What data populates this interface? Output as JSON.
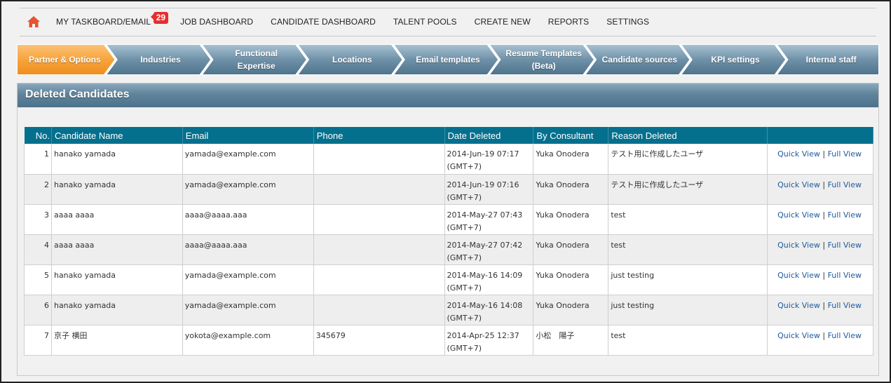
{
  "nav": {
    "items": [
      {
        "label": "MY TASKBOARD/EMAIL",
        "badge": "29"
      },
      {
        "label": "JOB DASHBOARD"
      },
      {
        "label": "CANDIDATE DASHBOARD"
      },
      {
        "label": "TALENT POOLS"
      },
      {
        "label": "CREATE NEW"
      },
      {
        "label": "REPORTS"
      },
      {
        "label": "SETTINGS"
      }
    ]
  },
  "steps": [
    {
      "line1": "Partner & Options",
      "line2": "",
      "active": true
    },
    {
      "line1": "Industries",
      "line2": ""
    },
    {
      "line1": "Functional",
      "line2": "Expertise"
    },
    {
      "line1": "Locations",
      "line2": ""
    },
    {
      "line1": "Email templates",
      "line2": ""
    },
    {
      "line1": "Resume Templates",
      "line2": "(Beta)"
    },
    {
      "line1": "Candidate sources",
      "line2": ""
    },
    {
      "line1": "KPI settings",
      "line2": ""
    },
    {
      "line1": "Internal staff",
      "line2": ""
    }
  ],
  "colors": {
    "step_active": "#f7a43c",
    "step_inactive": "#5e819a",
    "header": "#05708e"
  },
  "panel": {
    "title": "Deleted Candidates"
  },
  "table": {
    "headers": [
      "No.",
      "Candidate Name",
      "Email",
      "Phone",
      "Date Deleted",
      "By Consultant",
      "Reason Deleted",
      ""
    ],
    "quick_view": "Quick View",
    "separator": "|",
    "full_view": "Full View",
    "rows": [
      {
        "no": "1",
        "name": "hanako yamada",
        "email": "yamada@example.com",
        "phone": "",
        "date": "2014-Jun-19 07:17",
        "tz": "(GMT+7)",
        "consultant": "Yuka Onodera",
        "reason": "テスト用に作成したユーザ"
      },
      {
        "no": "2",
        "name": "hanako yamada",
        "email": "yamada@example.com",
        "phone": "",
        "date": "2014-Jun-19 07:16",
        "tz": "(GMT+7)",
        "consultant": "Yuka Onodera",
        "reason": "テスト用に作成したユーザ"
      },
      {
        "no": "3",
        "name": "aaaa aaaa",
        "email": "aaaa@aaaa.aaa",
        "phone": "",
        "date": "2014-May-27 07:43",
        "tz": "(GMT+7)",
        "consultant": "Yuka Onodera",
        "reason": "test"
      },
      {
        "no": "4",
        "name": "aaaa aaaa",
        "email": "aaaa@aaaa.aaa",
        "phone": "",
        "date": "2014-May-27 07:42",
        "tz": "(GMT+7)",
        "consultant": "Yuka Onodera",
        "reason": "test"
      },
      {
        "no": "5",
        "name": "hanako yamada",
        "email": "yamada@example.com",
        "phone": "",
        "date": "2014-May-16 14:09",
        "tz": "(GMT+7)",
        "consultant": "Yuka Onodera",
        "reason": "just testing"
      },
      {
        "no": "6",
        "name": "hanako yamada",
        "email": "yamada@example.com",
        "phone": "",
        "date": "2014-May-16 14:08",
        "tz": "(GMT+7)",
        "consultant": "Yuka Onodera",
        "reason": "just testing"
      },
      {
        "no": "7",
        "name": "京子 横田",
        "email": "yokota@example.com",
        "phone": "345679",
        "date": "2014-Apr-25 12:37",
        "tz": "(GMT+7)",
        "consultant": "小松　陽子",
        "reason": "test"
      }
    ]
  }
}
